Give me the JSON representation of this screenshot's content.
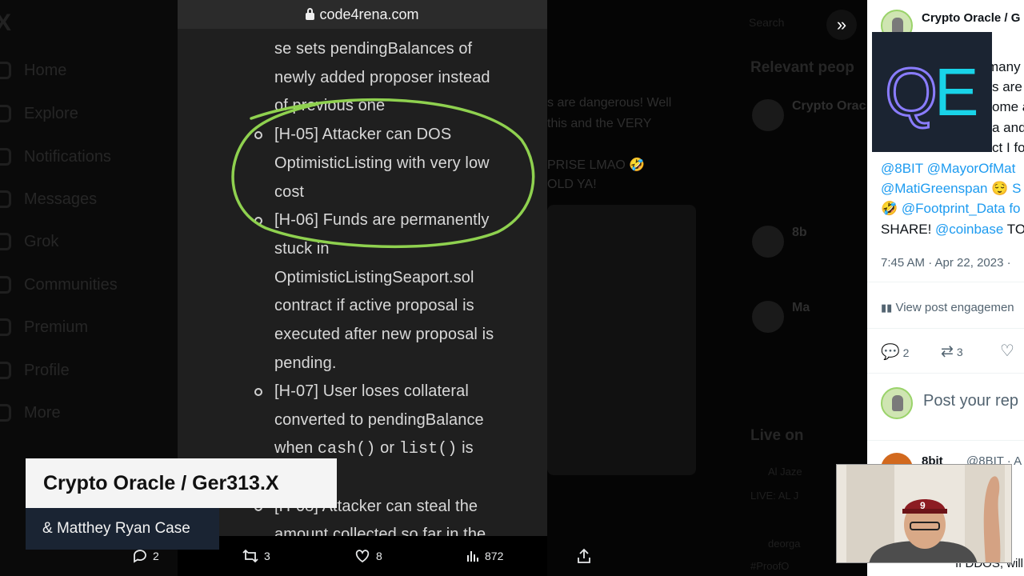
{
  "url": "code4rena.com",
  "document_lines": [
    "se sets pendingBalances of",
    "newly added proposer instead",
    "of previous one",
    "[H-05] Attacker can DOS",
    "OptimisticListing with very low",
    "cost",
    "[H-06] Funds are permanently",
    "stuck in",
    "OptimisticListingSeaport.sol",
    "contract if active proposal is",
    "executed after new proposal is",
    "pending.",
    "[H-07] User loses collateral",
    "converted to pendingBalance",
    "[H-08] Attacker can steal the",
    "amount collected so far in the"
  ],
  "doc_code_line": {
    "prefix": "when ",
    "code1": "cash()",
    "mid": " or ",
    "code2": "list()",
    "suffix": " is"
  },
  "sidebar": {
    "items": [
      "Home",
      "Explore",
      "Notifications",
      "Messages",
      "Grok",
      "Communities",
      "Premium",
      "Profile",
      "More"
    ]
  },
  "feed": {
    "search": "Search",
    "relevant": "Relevant peop",
    "live": "Live on",
    "lines": [
      "s are dangerous! Well",
      "this and the VERY",
      "PRISE LMAO 🤣",
      "OLD YA!"
    ],
    "people": [
      "Crypto Orac",
      "8b",
      "Ma"
    ],
    "live_items": [
      "Al Jaze",
      "LIVE: AL J",
      "deorga",
      "#ProofO"
    ]
  },
  "right_panel": {
    "author": "Crypto Oracle / G",
    "text_lines": [
      "many",
      "s are",
      "ome a",
      "a and",
      "ct I fo"
    ],
    "mentions_line1": "@8BIT @MayorOfMat",
    "mentions_line2": "@MatiGreenspan 😌 S",
    "mentions_line3": "@Footprint_Data fo",
    "share_prefix": "SHARE! ",
    "share_link": "@coinbase",
    "share_suffix": " TO",
    "timestamp": "7:45 AM · Apr 22, 2023 ·",
    "engagements": "View post engagemen",
    "replies": "2",
    "reposts": "3",
    "reply_placeholder": "Post your rep",
    "reply_author": "8bit",
    "reply_handle": "@8BIT · A",
    "reply_text": "If DDOS, will it"
  },
  "lower_third": {
    "name": "Crypto Oracle / Ger313.X",
    "subtitle": "& Matthey Ryan Case"
  },
  "action_bar": {
    "replies": "2",
    "reposts": "3",
    "likes": "8",
    "views": "872"
  },
  "logo_letters": "QE"
}
